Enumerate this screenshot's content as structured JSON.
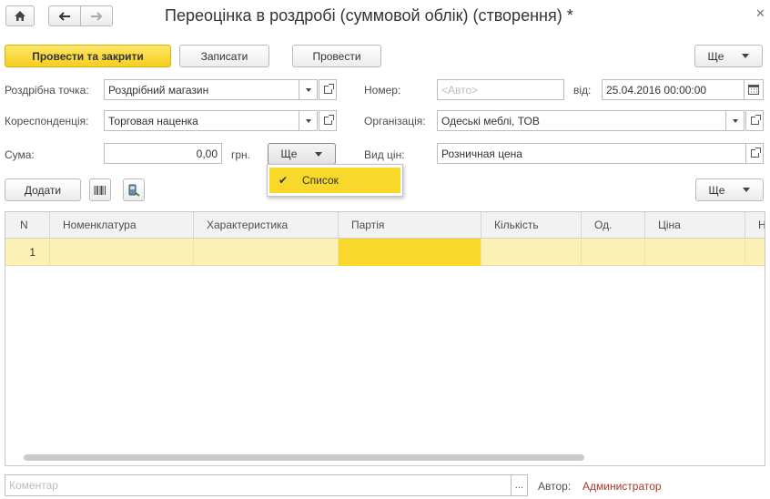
{
  "window": {
    "title": "Переоцінка в роздробі (суммовой облік) (створення) *",
    "home_icon": "home-icon",
    "back_icon": "arrow-left-icon",
    "forward_icon": "arrow-right-icon",
    "close_icon": "close-icon"
  },
  "toolbar": {
    "post_close_label": "Провести та закрити",
    "save_label": "Записати",
    "post_label": "Провести",
    "more_label": "Ще"
  },
  "form": {
    "retail_point": {
      "label": "Роздрібна точка:",
      "value": "Роздрібний магазин"
    },
    "correspondence": {
      "label": "Кореспонденція:",
      "value": "Торговая наценка"
    },
    "sum": {
      "label": "Сума:",
      "value": "0,00",
      "currency": "грн.",
      "more_label": "Ще"
    },
    "number": {
      "label": "Номер:",
      "placeholder": "<Авто>"
    },
    "date": {
      "label": "від:",
      "value": "25.04.2016 00:00:00"
    },
    "organization": {
      "label": "Організація:",
      "value": "Одеські меблі, ТОВ"
    },
    "price_type": {
      "label": "Вид цін:",
      "value": "Розничная цена"
    }
  },
  "dropdown": {
    "items": [
      {
        "label": "Список",
        "checked": true
      }
    ]
  },
  "table_toolbar": {
    "add_label": "Додати",
    "more_label": "Ще"
  },
  "table": {
    "columns": [
      "N",
      "Номенклатура",
      "Характеристика",
      "Партія",
      "Кількість",
      "Од.",
      "Ціна",
      "Н"
    ],
    "rows": [
      {
        "n": "1"
      }
    ]
  },
  "footer": {
    "comment_placeholder": "Коментар",
    "ellipsis": "...",
    "author_label": "Автор:",
    "author_value": "Администратор"
  },
  "colors": {
    "accent": "#f8d92b",
    "author_link": "#a4392a"
  }
}
